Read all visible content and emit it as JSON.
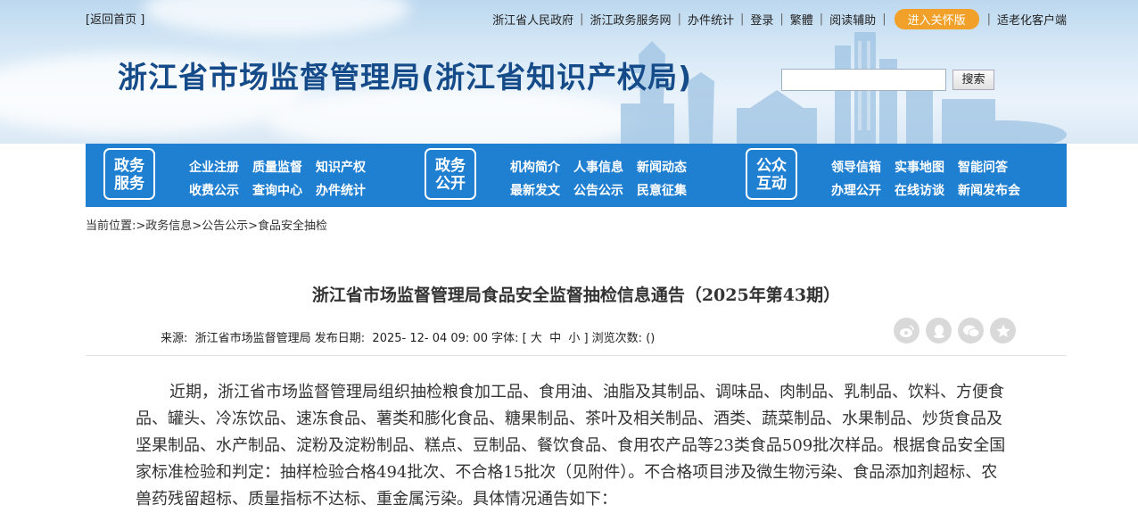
{
  "header": {
    "back_home": "[返回首页 ]",
    "links": [
      "浙江省人民政府",
      "浙江政务服务网",
      "办件统计",
      "登录",
      "繁體",
      "阅读辅助"
    ],
    "care_mode": "进入关怀版",
    "elder_client": "适老化客户端",
    "site_title": "浙江省市场监督管理局(浙江省知识产权局)",
    "search_button": "搜索",
    "care_color": "#f1a12a"
  },
  "nav": {
    "color": "#1f7fd1",
    "groups": [
      {
        "badge": [
          "政务",
          "服务"
        ],
        "rows": [
          [
            "企业注册",
            "质量监督",
            "知识产权"
          ],
          [
            "收费公示",
            "查询中心",
            "办件统计"
          ]
        ]
      },
      {
        "badge": [
          "政务",
          "公开"
        ],
        "rows": [
          [
            "机构简介",
            "人事信息",
            "新闻动态"
          ],
          [
            "最新发文",
            "公告公示",
            "民意征集"
          ]
        ]
      },
      {
        "badge": [
          "公众",
          "互动"
        ],
        "rows": [
          [
            "领导信箱",
            "实事地图",
            "智能问答"
          ],
          [
            "办理公开",
            "在线访谈",
            "新闻发布会"
          ]
        ]
      }
    ]
  },
  "breadcrumb": "当前位置:>政务信息>公告公示>食品安全抽检",
  "article": {
    "title": "浙江省市场监督管理局食品安全监督抽检信息通告（2025年第43期）",
    "meta": "来源:  浙江省市场监督管理局 发布日期:  2025- 12- 04 09: 00 字体: [ 大  中  小 ] 浏览次数: ()",
    "share_icons": [
      "weibo-icon",
      "qq-icon",
      "wechat-icon",
      "favorite-icon"
    ],
    "body": "近期，浙江省市场监督管理局组织抽检粮食加工品、食用油、油脂及其制品、调味品、肉制品、乳制品、饮料、方便食品、罐头、冷冻饮品、速冻食品、薯类和膨化食品、糖果制品、茶叶及相关制品、酒类、蔬菜制品、水果制品、炒货食品及坚果制品、水产制品、淀粉及淀粉制品、糕点、豆制品、餐饮食品、食用农产品等23类食品509批次样品。根据食品安全国家标准检验和判定：抽样检验合格494批次、不合格15批次（见附件）。不合格项目涉及微生物污染、食品添加剂超标、农兽药残留超标、质量指标不达标、重金属污染。具体情况通告如下："
  }
}
